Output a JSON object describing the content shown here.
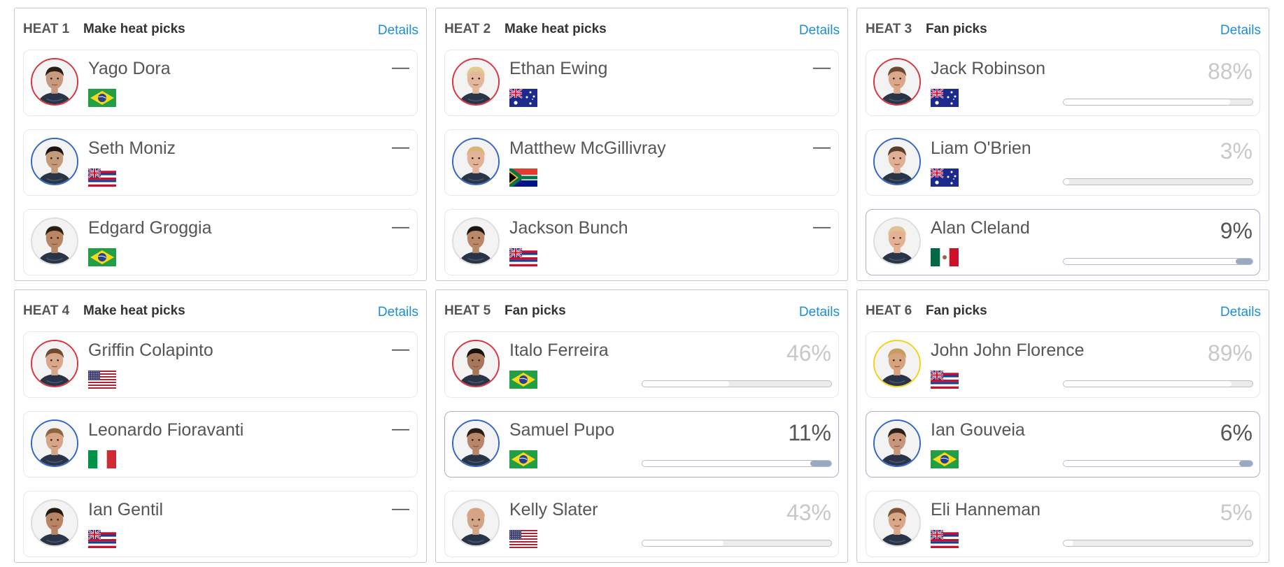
{
  "colors": {
    "link": "#1a8fd6",
    "red": "#d9343f",
    "blue": "#3466c4",
    "yellow": "#f2d21b",
    "white": "#dddddd",
    "selected_fill": "#97aac1"
  },
  "heats": [
    {
      "heat_label": "HEAT 1",
      "action_label": "Make heat picks",
      "details_label": "Details",
      "athletes": [
        {
          "name": "Yago Dora",
          "country": "Brazil",
          "flag": "br",
          "jersey": "red",
          "skin": "#c79a7e",
          "hair": "#2a1c16",
          "status": "—"
        },
        {
          "name": "Seth Moniz",
          "country": "Hawaii",
          "flag": "hi",
          "jersey": "blue",
          "skin": "#c59a78",
          "hair": "#1a1412",
          "status": "—"
        },
        {
          "name": "Edgard Groggia",
          "country": "Brazil",
          "flag": "br",
          "jersey": "white",
          "skin": "#b98664",
          "hair": "#2b1e17",
          "status": "—"
        }
      ]
    },
    {
      "heat_label": "HEAT 2",
      "action_label": "Make heat picks",
      "details_label": "Details",
      "athletes": [
        {
          "name": "Ethan Ewing",
          "country": "Australia",
          "flag": "au",
          "jersey": "red",
          "skin": "#e3b79b",
          "hair": "#e2c98f",
          "status": "—"
        },
        {
          "name": "Matthew McGillivray",
          "country": "South Africa",
          "flag": "za",
          "jersey": "blue",
          "skin": "#e2b396",
          "hair": "#d8b67a",
          "status": "—"
        },
        {
          "name": "Jackson Bunch",
          "country": "Hawaii",
          "flag": "hi",
          "jersey": "white",
          "skin": "#b98866",
          "hair": "#1c1714",
          "status": "—"
        }
      ]
    },
    {
      "heat_label": "HEAT 3",
      "action_label": "Fan picks",
      "details_label": "Details",
      "athletes": [
        {
          "name": "Jack Robinson",
          "country": "Australia",
          "flag": "au",
          "jersey": "red",
          "skin": "#dba98a",
          "hair": "#6b4a33",
          "pct_label": "88%",
          "pct": 0.88,
          "selected": false
        },
        {
          "name": "Liam O'Brien",
          "country": "Australia",
          "flag": "au",
          "jersey": "blue",
          "skin": "#e0ae92",
          "hair": "#5a3d2a",
          "pct_label": "3%",
          "pct": 0.03,
          "selected": false
        },
        {
          "name": "Alan Cleland",
          "country": "Mexico",
          "flag": "mx",
          "jersey": "white",
          "skin": "#e4b292",
          "hair": "#ddc392",
          "pct_label": "9%",
          "pct": 0.09,
          "selected": true
        }
      ]
    },
    {
      "heat_label": "HEAT 4",
      "action_label": "Make heat picks",
      "details_label": "Details",
      "athletes": [
        {
          "name": "Griffin Colapinto",
          "country": "United States",
          "flag": "us",
          "jersey": "red",
          "skin": "#d9a88a",
          "hair": "#6d4b31",
          "status": "—"
        },
        {
          "name": "Leonardo Fioravanti",
          "country": "Italy",
          "flag": "it",
          "jersey": "blue",
          "skin": "#d7a486",
          "hair": "#8a6642",
          "status": "—"
        },
        {
          "name": "Ian Gentil",
          "country": "Hawaii",
          "flag": "hi",
          "jersey": "white",
          "skin": "#b88464",
          "hair": "#231915",
          "status": "—"
        }
      ]
    },
    {
      "heat_label": "HEAT 5",
      "action_label": "Fan picks",
      "details_label": "Details",
      "athletes": [
        {
          "name": "Italo Ferreira",
          "country": "Brazil",
          "flag": "br",
          "jersey": "red",
          "skin": "#a8765a",
          "hair": "#17110e",
          "pct_label": "46%",
          "pct": 0.46,
          "selected": false
        },
        {
          "name": "Samuel Pupo",
          "country": "Brazil",
          "flag": "br",
          "jersey": "blue",
          "skin": "#b9866a",
          "hair": "#2a1c14",
          "pct_label": "11%",
          "pct": 0.11,
          "selected": true
        },
        {
          "name": "Kelly Slater",
          "country": "United States",
          "flag": "us",
          "jersey": "white",
          "skin": "#d3a486",
          "hair": "#d3a486",
          "pct_label": "43%",
          "pct": 0.43,
          "selected": false
        }
      ]
    },
    {
      "heat_label": "HEAT 6",
      "action_label": "Fan picks",
      "details_label": "Details",
      "athletes": [
        {
          "name": "John John Florence",
          "country": "Hawaii",
          "flag": "hi",
          "jersey": "yellow",
          "skin": "#d7a27e",
          "hair": "#c79d5e",
          "pct_label": "89%",
          "pct": 0.89,
          "selected": false
        },
        {
          "name": "Ian Gouveia",
          "country": "Brazil",
          "flag": "br",
          "jersey": "blue",
          "skin": "#c9967a",
          "hair": "#2d201a",
          "pct_label": "6%",
          "pct": 0.06,
          "selected": true
        },
        {
          "name": "Eli Hanneman",
          "country": "Hawaii",
          "flag": "hi",
          "jersey": "white",
          "skin": "#d9a686",
          "hair": "#7a5436",
          "pct_label": "5%",
          "pct": 0.05,
          "selected": false
        }
      ]
    }
  ]
}
